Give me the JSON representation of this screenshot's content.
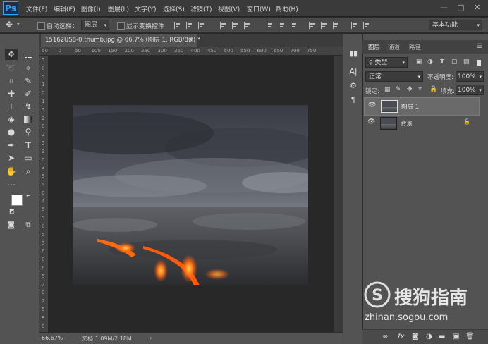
{
  "app": {
    "logo": "Ps"
  },
  "menu": [
    "文件(F)",
    "编辑(E)",
    "图像(I)",
    "图层(L)",
    "文字(Y)",
    "选择(S)",
    "滤镜(T)",
    "视图(V)",
    "窗口(W)",
    "帮助(H)"
  ],
  "window_controls": {
    "minimize": "—",
    "restore": "□",
    "close": "✕"
  },
  "options": {
    "auto_select_label": "自动选择：",
    "auto_select_value": "图层",
    "show_transform_label": "显示变换控件",
    "workspace": "基本功能"
  },
  "document": {
    "tab_title": "15162US8-0.thumb.jpg @ 66.7% (图层 1, RGB/8#) *",
    "tab_close": "×",
    "ruler_top": [
      "50",
      "0",
      "50",
      "100",
      "150",
      "200",
      "250",
      "300",
      "350",
      "400",
      "450",
      "500",
      "550",
      "600",
      "650",
      "700",
      "750"
    ],
    "ruler_left": [
      "5",
      "0",
      "5",
      "1",
      "0",
      "1",
      "5",
      "2",
      "0",
      "2",
      "5",
      "3",
      "0",
      "3",
      "5",
      "4",
      "0",
      "4",
      "5",
      "5",
      "0",
      "5",
      "5",
      "6",
      "0",
      "6",
      "5",
      "7",
      "0",
      "7",
      "5",
      "8",
      "0"
    ],
    "zoom": "66.67%",
    "doc_info": "文档:1.09M/2.18M",
    "status_arrow": "›"
  },
  "panel": {
    "tabs": [
      "图层",
      "通道",
      "路径"
    ],
    "filter_kind": "类型",
    "blend_mode": "正常",
    "opacity_label": "不透明度:",
    "opacity_value": "100%",
    "lock_label": "锁定:",
    "fill_label": "填充:",
    "fill_value": "100%",
    "layers": [
      {
        "name": "图层 1",
        "visible": true,
        "selected": true
      },
      {
        "name": "背景",
        "visible": true,
        "locked": true
      }
    ],
    "bottom_icons": [
      "link-icon",
      "fx-icon",
      "mask-icon",
      "adjustment-icon",
      "group-icon",
      "new-layer-icon",
      "delete-icon"
    ]
  },
  "watermark": {
    "brand": "搜狗指南",
    "url": "zhinan.sogou.com"
  },
  "colors": {
    "accent": "#31a8ff",
    "panel": "#535353",
    "canvas_bg": "#282828"
  }
}
